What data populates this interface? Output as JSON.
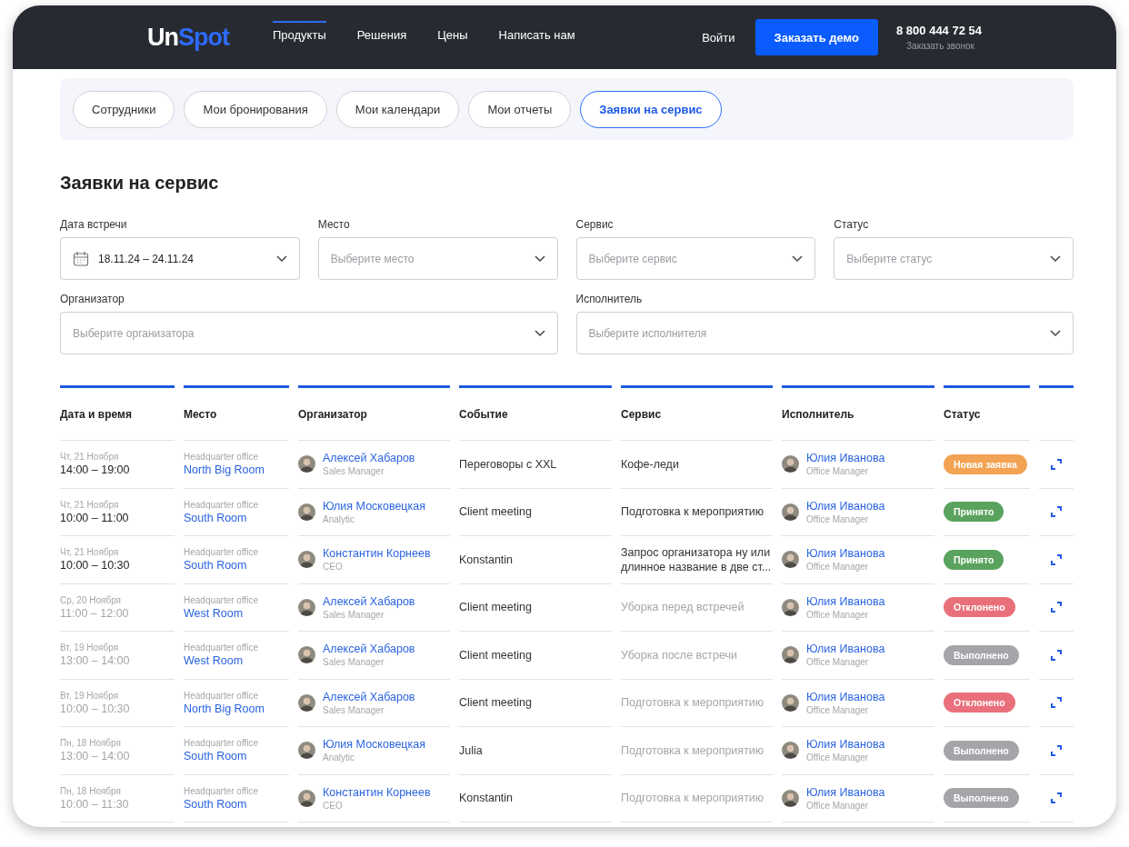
{
  "header": {
    "logo": {
      "part_1": "Un",
      "part_2": "Spot"
    },
    "nav": [
      {
        "label": "Продукты",
        "selected": true
      },
      {
        "label": "Решения",
        "selected": false
      },
      {
        "label": "Цены",
        "selected": false
      },
      {
        "label": "Написать нам",
        "selected": false
      }
    ],
    "login": "Войти",
    "demo_button": "Заказать демо",
    "phone": "8 800 444 72 54",
    "callback": "Заказать звонок"
  },
  "tabs": [
    {
      "label": "Сотрудники",
      "selected": false
    },
    {
      "label": "Мои бронирования",
      "selected": false
    },
    {
      "label": "Мои календари",
      "selected": false
    },
    {
      "label": "Мои отчеты",
      "selected": false
    },
    {
      "label": "Заявки на сервис",
      "selected": true
    }
  ],
  "title": "Заявки на сервис",
  "filters": [
    {
      "label": "Дата встречи",
      "value": "18.11.24 – 24.11.24",
      "kind": "date"
    },
    {
      "label": "Место",
      "placeholder": "Выберите место",
      "kind": "select"
    },
    {
      "label": "Сервис",
      "placeholder": "Выберите сервис",
      "kind": "select"
    },
    {
      "label": "Статус",
      "placeholder": "Выберите статус",
      "kind": "select"
    },
    {
      "label": "Организатор",
      "placeholder": "Выберите организатора",
      "kind": "select"
    },
    {
      "label": "Исполнитель",
      "placeholder": "Выберите исполнителя",
      "kind": "select"
    }
  ],
  "table": {
    "columns": [
      "Дата и время",
      "Место",
      "Организатор",
      "Событие",
      "Сервис",
      "Исполнитель",
      "Статус"
    ],
    "rows": [
      {
        "date": "Чт, 21 Ноября",
        "time": "14:00 – 19:00",
        "past": false,
        "office": "Headquarter office",
        "room": "North Big Room",
        "organizer": "Алексей Хабаров",
        "organizer_role": "Sales Manager",
        "event": "Переговоры с XXL",
        "service": "Кофе-леди",
        "executor": "Юлия Иванова",
        "executor_role": "Office Manager",
        "status": {
          "label": "Новая заявка",
          "kind": "new"
        }
      },
      {
        "date": "Чт, 21 Ноября",
        "time": "10:00 – 11:00",
        "past": false,
        "office": "Headquarter office",
        "room": "South Room",
        "organizer": "Юлия Московецкая",
        "organizer_role": "Analytic",
        "event": "Client meeting",
        "service": "Подготовка к мероприятию",
        "executor": "Юлия Иванова",
        "executor_role": "Office Manager",
        "status": {
          "label": "Принято",
          "kind": "accepted"
        }
      },
      {
        "date": "Чт, 21 Ноября",
        "time": "10:00 – 10:30",
        "past": false,
        "office": "Headquarter office",
        "room": "South Room",
        "organizer": "Константин Корнеев",
        "organizer_role": "CEO",
        "event": "Konstantin",
        "service": "Запрос организатора ну или длинное название в две ст...",
        "executor": "Юлия Иванова",
        "executor_role": "Office Manager",
        "status": {
          "label": "Принято",
          "kind": "accepted"
        }
      },
      {
        "date": "Ср, 20 Ноября",
        "time": "11:00 – 12:00",
        "past": true,
        "office": "Headquarter office",
        "room": "West Room",
        "organizer": "Алексей Хабаров",
        "organizer_role": "Sales Manager",
        "event": "Client meeting",
        "service": "Уборка перед встречей",
        "executor": "Юлия Иванова",
        "executor_role": "Office Manager",
        "status": {
          "label": "Отклонено",
          "kind": "rejected"
        }
      },
      {
        "date": "Вт, 19 Ноября",
        "time": "13:00 – 14:00",
        "past": true,
        "office": "Headquarter office",
        "room": "West Room",
        "organizer": "Алексей Хабаров",
        "organizer_role": "Sales Manager",
        "event": "Client meeting",
        "service": "Уборка после встречи",
        "executor": "Юлия Иванова",
        "executor_role": "Office Manager",
        "status": {
          "label": "Выполнено",
          "kind": "done"
        }
      },
      {
        "date": "Вт, 19 Ноября",
        "time": "10:00 – 10:30",
        "past": true,
        "office": "Headquarter office",
        "room": "North Big Room",
        "organizer": "Алексей Хабаров",
        "organizer_role": "Sales Manager",
        "event": "Client meeting",
        "service": "Подготовка к мероприятию",
        "executor": "Юлия Иванова",
        "executor_role": "Office Manager",
        "status": {
          "label": "Отклонено",
          "kind": "rejected"
        }
      },
      {
        "date": "Пн, 18 Ноября",
        "time": "13:00 – 14:00",
        "past": true,
        "office": "Headquarter office",
        "room": "South Room",
        "organizer": "Юлия Московецкая",
        "organizer_role": "Analytic",
        "event": "Julia",
        "service": "Подготовка к мероприятию",
        "executor": "Юлия Иванова",
        "executor_role": "Office Manager",
        "status": {
          "label": "Выполнено",
          "kind": "done"
        }
      },
      {
        "date": "Пн, 18 Ноября",
        "time": "10:00 – 11:30",
        "past": true,
        "office": "Headquarter office",
        "room": "South Room",
        "organizer": "Константин Корнеев",
        "organizer_role": "CEO",
        "event": "Konstantin",
        "service": "Подготовка к мероприятию",
        "executor": "Юлия Иванова",
        "executor_role": "Office Manager",
        "status": {
          "label": "Выполнено",
          "kind": "done"
        }
      }
    ]
  }
}
